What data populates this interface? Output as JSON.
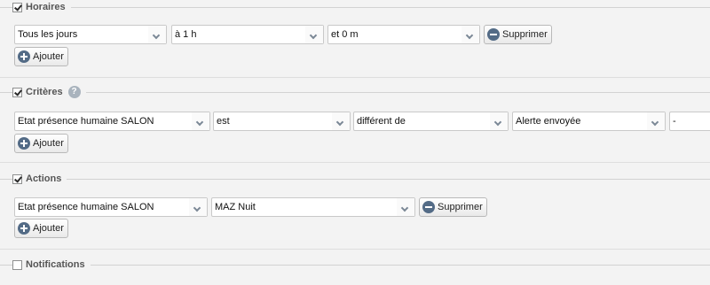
{
  "horaires": {
    "label": "Horaires",
    "checked": true,
    "day": "Tous les jours",
    "hour": "à 1 h",
    "minute": "et 0 m",
    "delete_label": "Supprimer",
    "add_label": "Ajouter"
  },
  "criteres": {
    "label": "Critères",
    "checked": true,
    "help_glyph": "?",
    "device": "Etat présence humaine SALON",
    "operator": "est",
    "comparison": "différent de",
    "value": "Alerte envoyée",
    "extra": "-",
    "add_label": "Ajouter"
  },
  "actions": {
    "label": "Actions",
    "checked": true,
    "device": "Etat présence humaine SALON",
    "value": "MAZ Nuit",
    "delete_label": "Supprimer",
    "add_label": "Ajouter"
  },
  "notifications": {
    "label": "Notifications",
    "checked": false
  }
}
